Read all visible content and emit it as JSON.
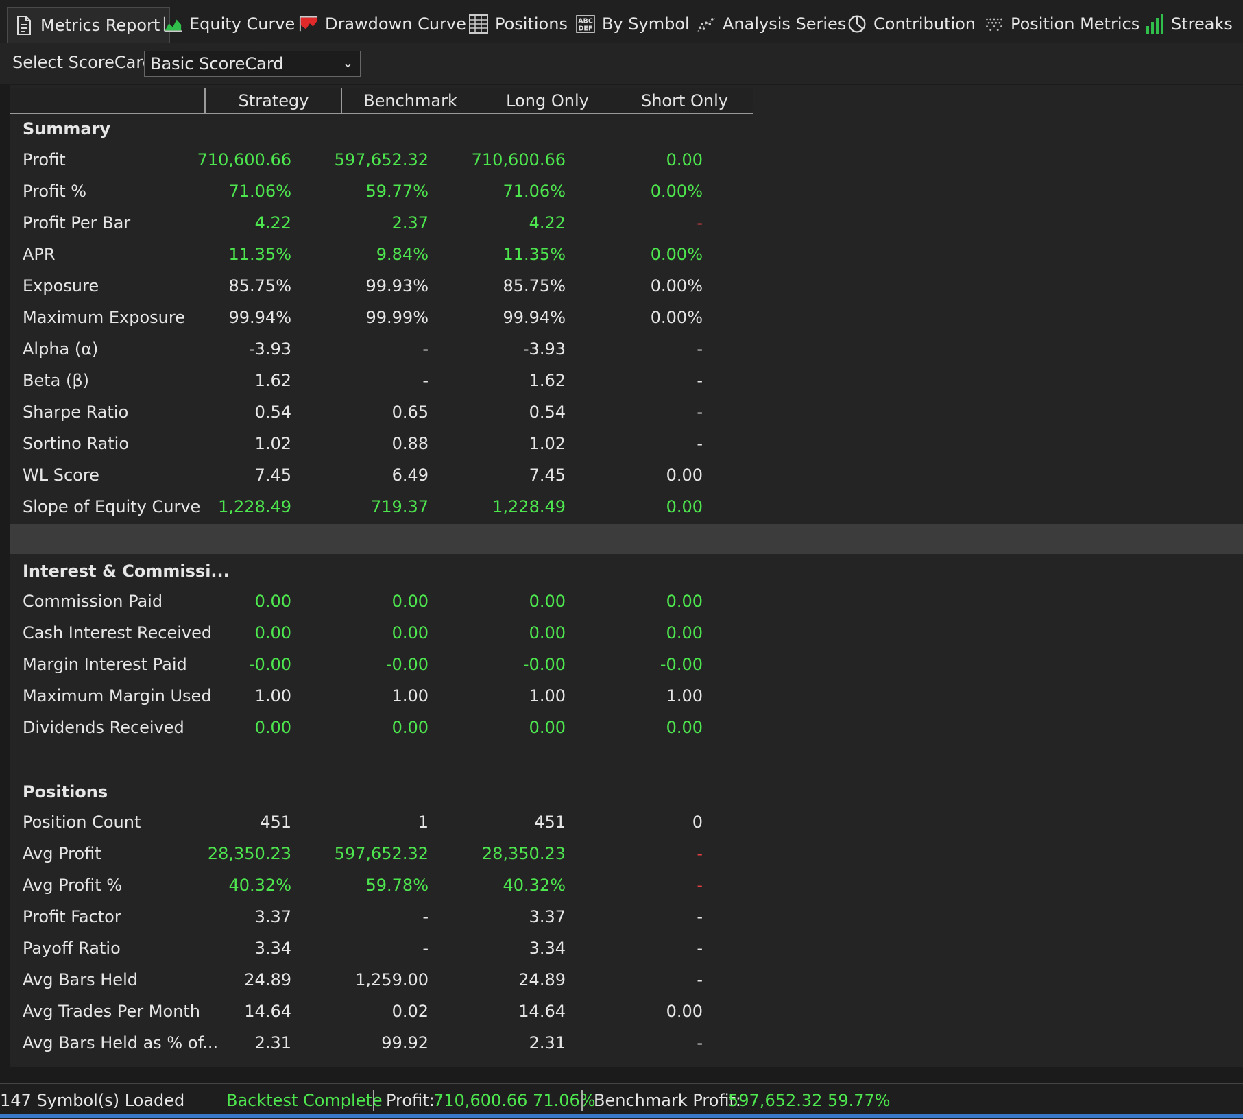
{
  "tabs": [
    {
      "label": "Metrics Report",
      "icon": "document-icon"
    },
    {
      "label": "Equity Curve",
      "icon": "area-chart-icon"
    },
    {
      "label": "Drawdown Curve",
      "icon": "drawdown-icon"
    },
    {
      "label": "Positions",
      "icon": "table-icon"
    },
    {
      "label": "By Symbol",
      "icon": "abc-icon"
    },
    {
      "label": "Analysis Series",
      "icon": "scatter-icon"
    },
    {
      "label": "Contribution",
      "icon": "pie-icon"
    },
    {
      "label": "Position Metrics",
      "icon": "dots-icon"
    },
    {
      "label": "Streaks",
      "icon": "bar-chart-icon"
    }
  ],
  "scorecard": {
    "label": "Select ScoreCard:",
    "value": "Basic ScoreCard"
  },
  "columns": [
    "Strategy",
    "Benchmark",
    "Long Only",
    "Short Only"
  ],
  "colors": {
    "positive": "#4ee64e",
    "negative_dash": "#e04040",
    "accent_line": "#3a78c8"
  },
  "summary": {
    "title": "Summary",
    "rows": [
      {
        "label": "Profit",
        "values": [
          "710,600.66",
          "597,652.32",
          "710,600.66",
          "0.00"
        ],
        "colors": [
          "green",
          "green",
          "green",
          "green"
        ]
      },
      {
        "label": "Profit %",
        "values": [
          "71.06%",
          "59.77%",
          "71.06%",
          "0.00%"
        ],
        "colors": [
          "green",
          "green",
          "green",
          "green"
        ]
      },
      {
        "label": "Profit Per Bar",
        "values": [
          "4.22",
          "2.37",
          "4.22",
          "-"
        ],
        "colors": [
          "green",
          "green",
          "green",
          "red"
        ]
      },
      {
        "label": "APR",
        "values": [
          "11.35%",
          "9.84%",
          "11.35%",
          "0.00%"
        ],
        "colors": [
          "green",
          "green",
          "green",
          "green"
        ]
      },
      {
        "label": "Exposure",
        "values": [
          "85.75%",
          "99.93%",
          "85.75%",
          "0.00%"
        ],
        "colors": [
          "",
          "",
          "",
          ""
        ]
      },
      {
        "label": "Maximum Exposure",
        "values": [
          "99.94%",
          "99.99%",
          "99.94%",
          "0.00%"
        ],
        "colors": [
          "",
          "",
          "",
          ""
        ]
      },
      {
        "label": "Alpha (α)",
        "values": [
          "-3.93",
          "-",
          "-3.93",
          "-"
        ],
        "colors": [
          "",
          "",
          "",
          ""
        ]
      },
      {
        "label": "Beta (β)",
        "values": [
          "1.62",
          "-",
          "1.62",
          "-"
        ],
        "colors": [
          "",
          "",
          "",
          ""
        ]
      },
      {
        "label": "Sharpe Ratio",
        "values": [
          "0.54",
          "0.65",
          "0.54",
          "-"
        ],
        "colors": [
          "",
          "",
          "",
          ""
        ]
      },
      {
        "label": "Sortino Ratio",
        "values": [
          "1.02",
          "0.88",
          "1.02",
          "-"
        ],
        "colors": [
          "",
          "",
          "",
          ""
        ]
      },
      {
        "label": "WL Score",
        "values": [
          "7.45",
          "6.49",
          "7.45",
          "0.00"
        ],
        "colors": [
          "",
          "",
          "",
          ""
        ]
      },
      {
        "label": "Slope of Equity Curve",
        "values": [
          "1,228.49",
          "719.37",
          "1,228.49",
          "0.00"
        ],
        "colors": [
          "green",
          "green",
          "green",
          "green"
        ]
      }
    ]
  },
  "interest": {
    "title": "Interest & Commissi...",
    "rows": [
      {
        "label": "Commission Paid",
        "values": [
          "0.00",
          "0.00",
          "0.00",
          "0.00"
        ],
        "colors": [
          "green",
          "green",
          "green",
          "green"
        ]
      },
      {
        "label": "Cash Interest Received",
        "values": [
          "0.00",
          "0.00",
          "0.00",
          "0.00"
        ],
        "colors": [
          "green",
          "green",
          "green",
          "green"
        ]
      },
      {
        "label": "Margin Interest Paid",
        "values": [
          "-0.00",
          "-0.00",
          "-0.00",
          "-0.00"
        ],
        "colors": [
          "green",
          "green",
          "green",
          "green"
        ]
      },
      {
        "label": "Maximum Margin Used",
        "values": [
          "1.00",
          "1.00",
          "1.00",
          "1.00"
        ],
        "colors": [
          "",
          "",
          "",
          ""
        ]
      },
      {
        "label": "Dividends Received",
        "values": [
          "0.00",
          "0.00",
          "0.00",
          "0.00"
        ],
        "colors": [
          "green",
          "green",
          "green",
          "green"
        ]
      }
    ]
  },
  "positions": {
    "title": "Positions",
    "rows": [
      {
        "label": "Position Count",
        "values": [
          "451",
          "1",
          "451",
          "0"
        ],
        "colors": [
          "",
          "",
          "",
          ""
        ]
      },
      {
        "label": "Avg Profit",
        "values": [
          "28,350.23",
          "597,652.32",
          "28,350.23",
          "-"
        ],
        "colors": [
          "green",
          "green",
          "green",
          "red"
        ]
      },
      {
        "label": "Avg Profit %",
        "values": [
          "40.32%",
          "59.78%",
          "40.32%",
          "-"
        ],
        "colors": [
          "green",
          "green",
          "green",
          "red"
        ]
      },
      {
        "label": "Profit Factor",
        "values": [
          "3.37",
          "-",
          "3.37",
          "-"
        ],
        "colors": [
          "",
          "",
          "",
          ""
        ]
      },
      {
        "label": "Payoff Ratio",
        "values": [
          "3.34",
          "-",
          "3.34",
          "-"
        ],
        "colors": [
          "",
          "",
          "",
          ""
        ]
      },
      {
        "label": "Avg Bars Held",
        "values": [
          "24.89",
          "1,259.00",
          "24.89",
          "-"
        ],
        "colors": [
          "",
          "",
          "",
          ""
        ]
      },
      {
        "label": "Avg Trades Per Month",
        "values": [
          "14.64",
          "0.02",
          "14.64",
          "0.00"
        ],
        "colors": [
          "",
          "",
          "",
          ""
        ]
      },
      {
        "label": "Avg Bars Held as % of...",
        "values": [
          "2.31",
          "99.92",
          "2.31",
          "-"
        ],
        "colors": [
          "",
          "",
          "",
          ""
        ]
      }
    ]
  },
  "status": {
    "symbols": "147 Symbol(s) Loaded",
    "backtest": "Backtest Complete",
    "profit_label": "Profit:",
    "profit_value": "710,600.66 71.06%",
    "bench_label": "Benchmark Profit:",
    "bench_value": "597,652.32 59.77%"
  }
}
